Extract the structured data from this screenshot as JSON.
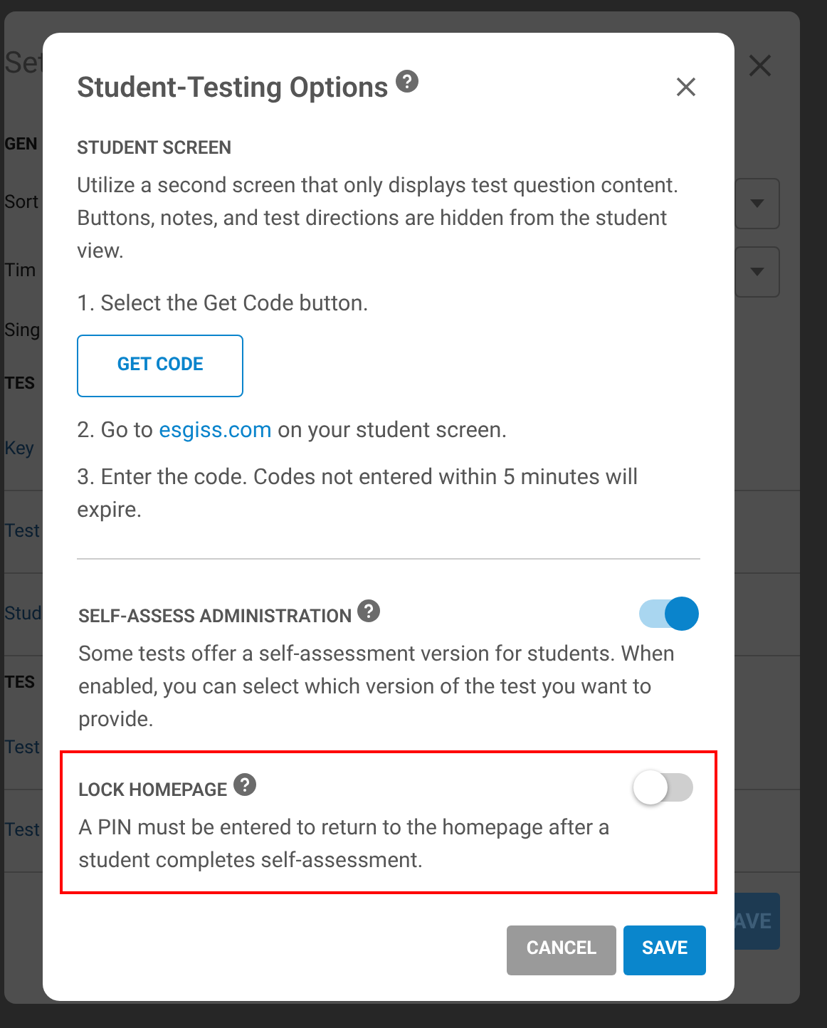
{
  "background_dialog": {
    "title": "Set",
    "rows": [
      {
        "kind": "heading",
        "text": "GEN"
      },
      {
        "kind": "select",
        "text": "Sort"
      },
      {
        "kind": "select",
        "text": "Tim"
      },
      {
        "kind": "label",
        "text": "Sing"
      },
      {
        "kind": "heading",
        "text": "TES"
      },
      {
        "kind": "link",
        "text": "Key"
      },
      {
        "kind": "link",
        "text": "Test"
      },
      {
        "kind": "link",
        "text": "Stud"
      },
      {
        "kind": "heading",
        "text": "TES"
      },
      {
        "kind": "link",
        "text": "Test"
      },
      {
        "kind": "link",
        "text": "Test"
      }
    ],
    "save_button": "AVE"
  },
  "dialog": {
    "title": "Student-Testing Options",
    "student_screen": {
      "heading": "STUDENT SCREEN",
      "description": "Utilize a second screen that only displays test question content. Buttons, notes, and test directions are hidden from the student view.",
      "step_1": "1. Select the Get Code button.",
      "get_code_button": "GET CODE",
      "step_2_before": "2. Go to",
      "step_2_link": "esgiss.com",
      "step_2_after": "on your student screen.",
      "step_3": "3. Enter the code. Codes not entered within 5 minutes will expire."
    },
    "settings": [
      {
        "heading": "SELF-ASSESS ADMINISTRATION",
        "description": "Some tests offer a self-assessment version for students. When enabled, you can select which version of the test you want to provide.",
        "on": true,
        "highlighted": false
      },
      {
        "heading": "LOCK HOMEPAGE",
        "description": "A PIN  must be entered to return to the homepage after a student completes self-assessment.",
        "on": false,
        "highlighted": true
      }
    ],
    "buttons": {
      "cancel": "CANCEL",
      "save": "SAVE"
    }
  }
}
